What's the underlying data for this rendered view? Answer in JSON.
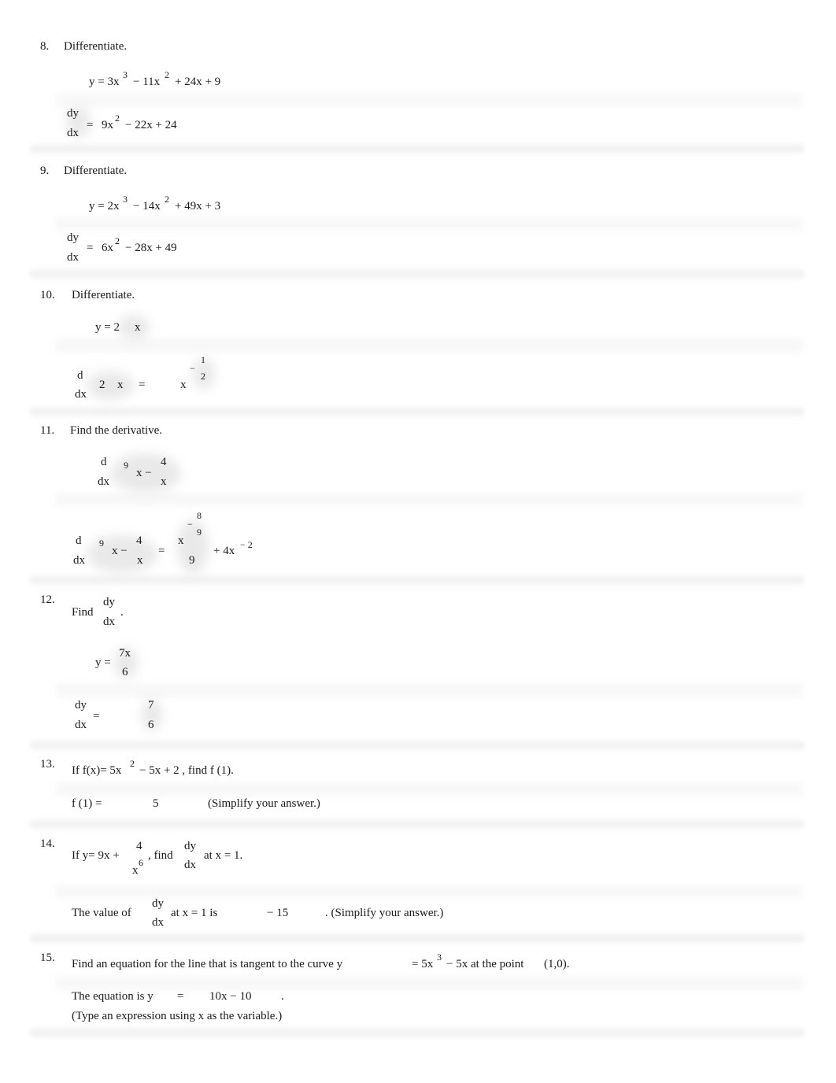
{
  "problems": [
    {
      "number": "8.",
      "prompt": "Differentiate.",
      "given": {
        "y": "y = 3x",
        "e1": "3",
        "t2": "− 11x",
        "e2": "2",
        "t3": "+ 24x + 9"
      },
      "answer": {
        "num": "dy",
        "den": "dx",
        "eq": "=",
        "t1": "9x",
        "e1": "2",
        "t2": "− 22x + 24"
      }
    },
    {
      "number": "9.",
      "prompt": "Differentiate.",
      "given": {
        "y": "y = 2x",
        "e1": "3",
        "t2": "− 14x",
        "e2": "2",
        "t3": "+ 49x + 3"
      },
      "answer": {
        "num": "dy",
        "den": "dx",
        "eq": "=",
        "t1": "6x",
        "e1": "2",
        "t2": "− 28x + 49"
      }
    },
    {
      "number": "10.",
      "prompt": "Differentiate.",
      "given": {
        "lhs": "y = 2",
        "x": "x"
      },
      "answer": {
        "num": "d",
        "den": "dx",
        "coef": "2",
        "x": "x",
        "eq": "=",
        "base": "x",
        "sign": "−",
        "exp_num": "1",
        "exp_den": "2"
      }
    },
    {
      "number": "11.",
      "prompt": "Find the derivative.",
      "given": {
        "num": "d",
        "den": "dx",
        "root": "9",
        "x": "x −",
        "fnum": "4",
        "fden": "x"
      },
      "answer": {
        "num": "d",
        "den": "dx",
        "root": "9",
        "x": "x −",
        "fnum": "4",
        "fden": "x",
        "eq": "=",
        "base": "x",
        "sign": "−",
        "exp_num": "8",
        "exp_den": "9",
        "div": "9",
        "tail": "+ 4x",
        "tail_exp": "− 2"
      }
    },
    {
      "number": "12.",
      "prompt_pre": "Find",
      "prompt_num": "dy",
      "prompt_den": "dx",
      "prompt_post": ".",
      "given": {
        "lhs": "y =",
        "num": "7x",
        "den": "6"
      },
      "answer": {
        "num": "dy",
        "den": "dx",
        "eq": "=",
        "vnum": "7",
        "vden": "6"
      }
    },
    {
      "number": "13.",
      "prompt_a": "If f(x)= 5x",
      "prompt_exp": "2",
      "prompt_b": "− 5x + 2 , find f (1).",
      "answer_label": "f (1) =",
      "answer_value": "5",
      "hint": "(Simplify your answer.)"
    },
    {
      "number": "14.",
      "prompt_a": "If y= 9x +",
      "frac_num": "4",
      "frac_den": "x",
      "frac_exp": "6",
      "prompt_b": ", find",
      "d_num": "dy",
      "d_den": "dx",
      "prompt_c": "at x  = 1.",
      "answer_pre": "The value of",
      "answer_num": "dy",
      "answer_den": "dx",
      "answer_mid": "at x  = 1 is",
      "answer_value": "− 15",
      "hint": ". (Simplify your answer.)"
    },
    {
      "number": "15.",
      "prompt_a": "Find an equation for the line that is tangent to the curve y",
      "prompt_b": "= 5x",
      "prompt_exp": "3",
      "prompt_c": "− 5x  at the point",
      "point": "(1,0).",
      "answer_label": "The equation is y",
      "answer_eq": "=",
      "answer_value": "10x − 10",
      "answer_end": ".",
      "hint": "(Type an expression using x as the variable.)"
    }
  ]
}
